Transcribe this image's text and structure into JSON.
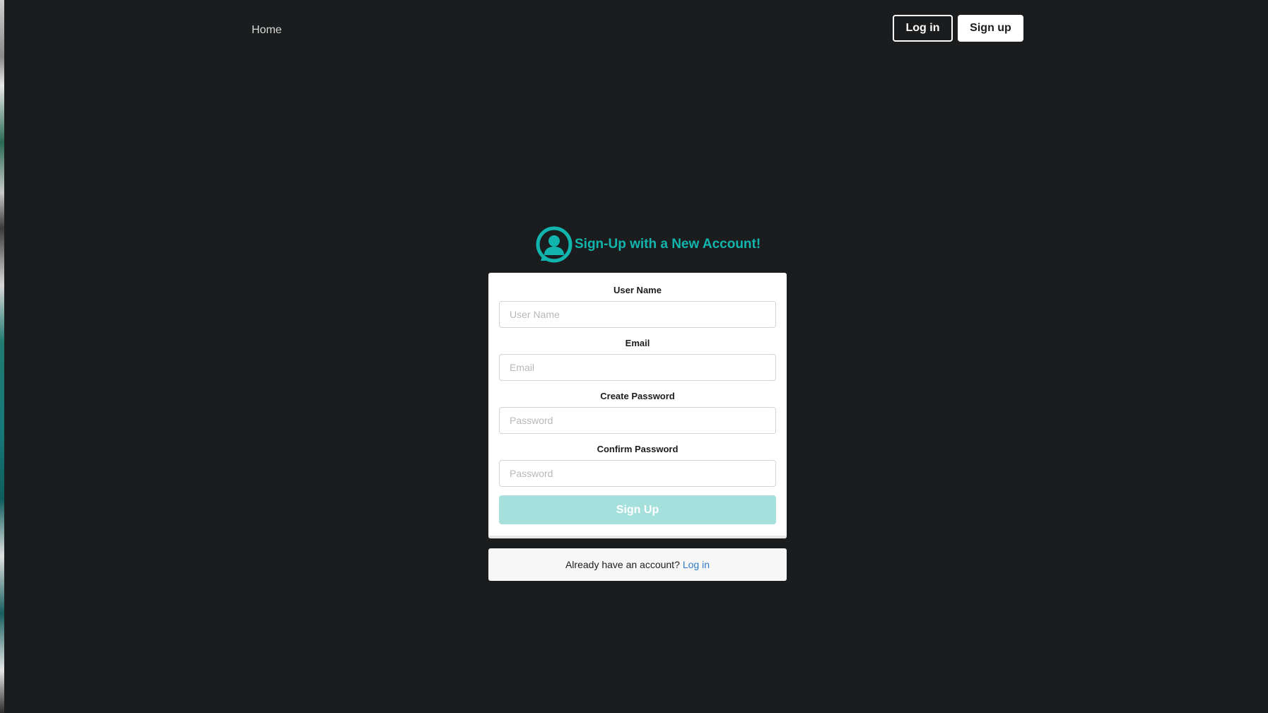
{
  "nav": {
    "home_label": "Home",
    "login_label": "Log in",
    "signup_label": "Sign up"
  },
  "heading": {
    "title": "Sign-Up with a New Account!",
    "icon": "user-circle-icon"
  },
  "form": {
    "username": {
      "label": "User Name",
      "placeholder": "User Name",
      "value": ""
    },
    "email": {
      "label": "Email",
      "placeholder": "Email",
      "value": ""
    },
    "password": {
      "label": "Create Password",
      "placeholder": "Password",
      "value": ""
    },
    "confirm": {
      "label": "Confirm Password",
      "placeholder": "Password",
      "value": ""
    },
    "submit_label": "Sign Up"
  },
  "message": {
    "text": "Already have an account?",
    "link_label": "Log in"
  },
  "colors": {
    "background": "#1b1c1d",
    "accent": "#12b5ae",
    "submit_disabled": "#a5e0dc",
    "link": "#2d7cc7"
  }
}
